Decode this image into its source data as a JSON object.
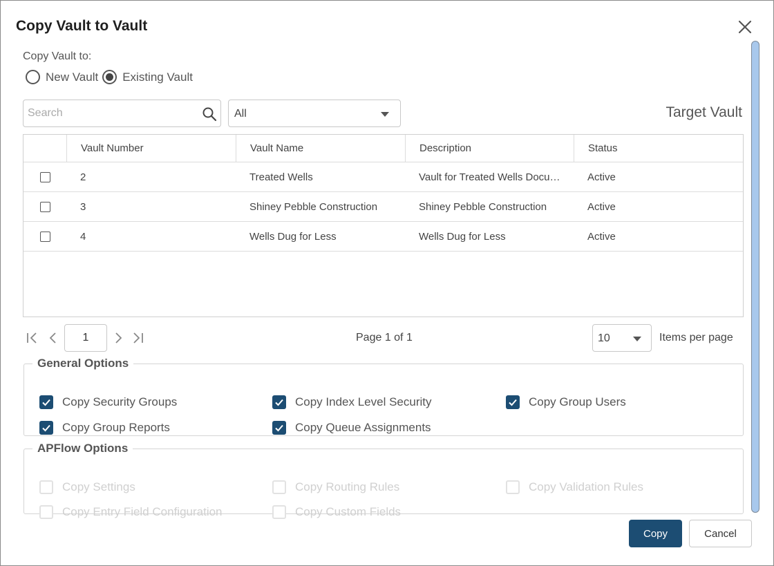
{
  "dialog": {
    "title": "Copy Vault to Vault"
  },
  "copy_to": {
    "label": "Copy Vault to:",
    "options": [
      "New Vault",
      "Existing Vault"
    ],
    "selected": "Existing Vault"
  },
  "search": {
    "placeholder": "Search",
    "value": ""
  },
  "filter": {
    "value": "All"
  },
  "target_vault_label": "Target Vault",
  "table": {
    "columns": [
      "Vault Number",
      "Vault Name",
      "Description",
      "Status"
    ],
    "rows": [
      {
        "number": "2",
        "name": "Treated Wells",
        "description": "Vault for Treated Wells Documents",
        "status": "Active",
        "checked": false
      },
      {
        "number": "3",
        "name": "Shiney Pebble Construction",
        "description": "Shiney Pebble Construction",
        "status": "Active",
        "checked": false
      },
      {
        "number": "4",
        "name": "Wells Dug for Less",
        "description": "Wells Dug for Less",
        "status": "Active",
        "checked": false
      }
    ]
  },
  "pager": {
    "current_page": "1",
    "page_info": "Page 1 of 1",
    "per_page": "10",
    "per_page_label": "Items per page"
  },
  "general_options": {
    "title": "General Options",
    "items": [
      {
        "label": "Copy Security Groups",
        "checked": true
      },
      {
        "label": "Copy Index Level Security",
        "checked": true
      },
      {
        "label": "Copy Group Users",
        "checked": true
      },
      {
        "label": "Copy Group Reports",
        "checked": true
      },
      {
        "label": "Copy Queue Assignments",
        "checked": true
      }
    ]
  },
  "apflow_options": {
    "title": "APFlow Options",
    "items": [
      {
        "label": "Copy Settings",
        "checked": false,
        "disabled": true
      },
      {
        "label": "Copy Routing Rules",
        "checked": false,
        "disabled": true
      },
      {
        "label": "Copy Validation Rules",
        "checked": false,
        "disabled": true
      },
      {
        "label": "Copy Entry Field Configuration",
        "checked": false,
        "disabled": true
      },
      {
        "label": "Copy Custom Fields",
        "checked": false,
        "disabled": true
      }
    ]
  },
  "buttons": {
    "copy": "Copy",
    "cancel": "Cancel"
  },
  "colors": {
    "primary": "#1c4d73",
    "scrollbar": "#a8c8ec"
  }
}
